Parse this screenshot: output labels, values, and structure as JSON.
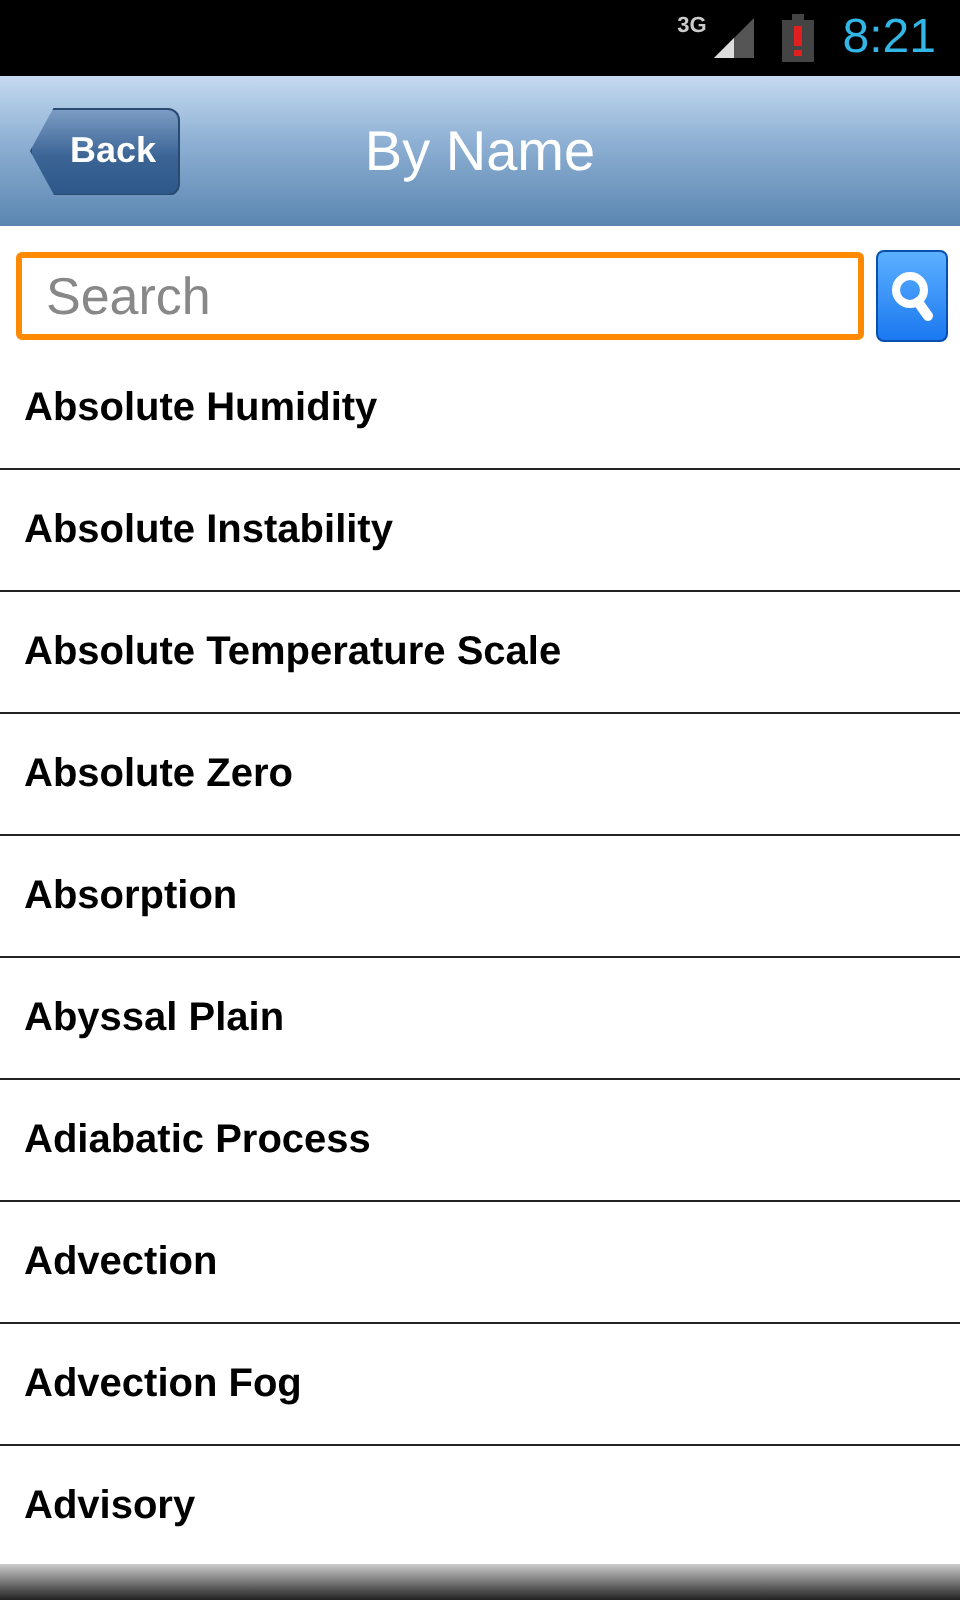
{
  "status_bar": {
    "network": "3G",
    "time": "8:21"
  },
  "header": {
    "back": "Back",
    "title": "By Name"
  },
  "search": {
    "placeholder": "Search"
  },
  "items": [
    {
      "label": "Absolute Humidity"
    },
    {
      "label": "Absolute Instability"
    },
    {
      "label": "Absolute Temperature Scale"
    },
    {
      "label": "Absolute Zero"
    },
    {
      "label": "Absorption"
    },
    {
      "label": "Abyssal Plain"
    },
    {
      "label": "Adiabatic Process"
    },
    {
      "label": "Advection"
    },
    {
      "label": "Advection Fog"
    },
    {
      "label": "Advisory"
    }
  ]
}
